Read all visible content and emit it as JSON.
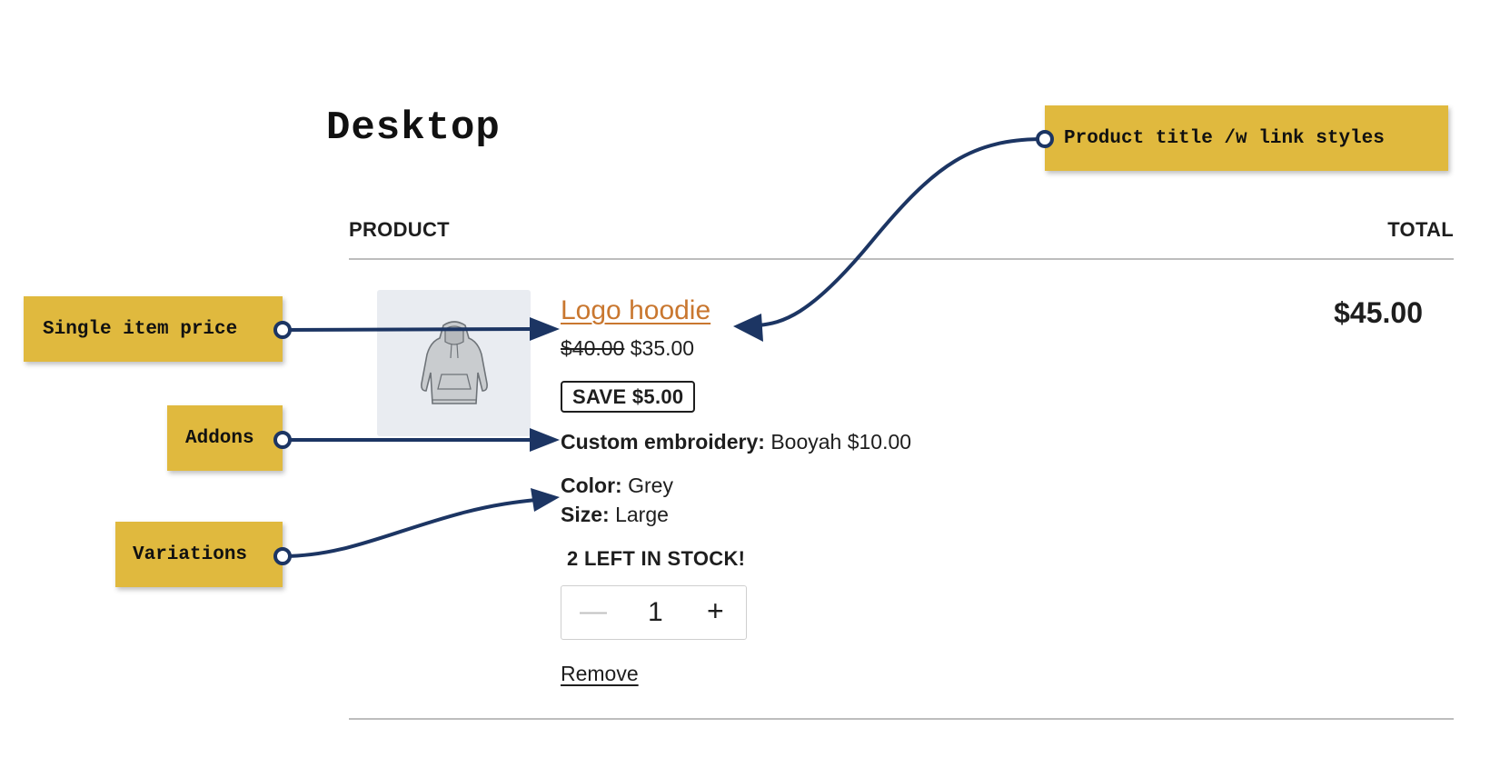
{
  "page": {
    "title": "Desktop"
  },
  "table": {
    "headers": {
      "product": "PRODUCT",
      "total": "TOTAL"
    }
  },
  "item": {
    "image_icon": "hoodie-image",
    "title": "Logo hoodie",
    "link_color": "#c9772f",
    "price_original": "$40.00",
    "price_current": "$35.00",
    "save_badge": "SAVE $5.00",
    "addon": {
      "label": "Custom embroidery:",
      "value": "Booyah $10.00"
    },
    "variations": [
      {
        "label": "Color:",
        "value": "Grey"
      },
      {
        "label": "Size:",
        "value": "Large"
      }
    ],
    "stock_notice": "2 LEFT IN STOCK!",
    "quantity": {
      "minus_icon": "minus-icon",
      "value": "1",
      "plus_icon": "plus-icon"
    },
    "remove_label": "Remove",
    "line_total": "$45.00"
  },
  "annotations": {
    "color_callout": "#e0b93e",
    "color_arrow": "#1c3563",
    "product_title": "Product title /w link styles",
    "single_price": "Single item price",
    "addons": "Addons",
    "variations": "Variations"
  }
}
